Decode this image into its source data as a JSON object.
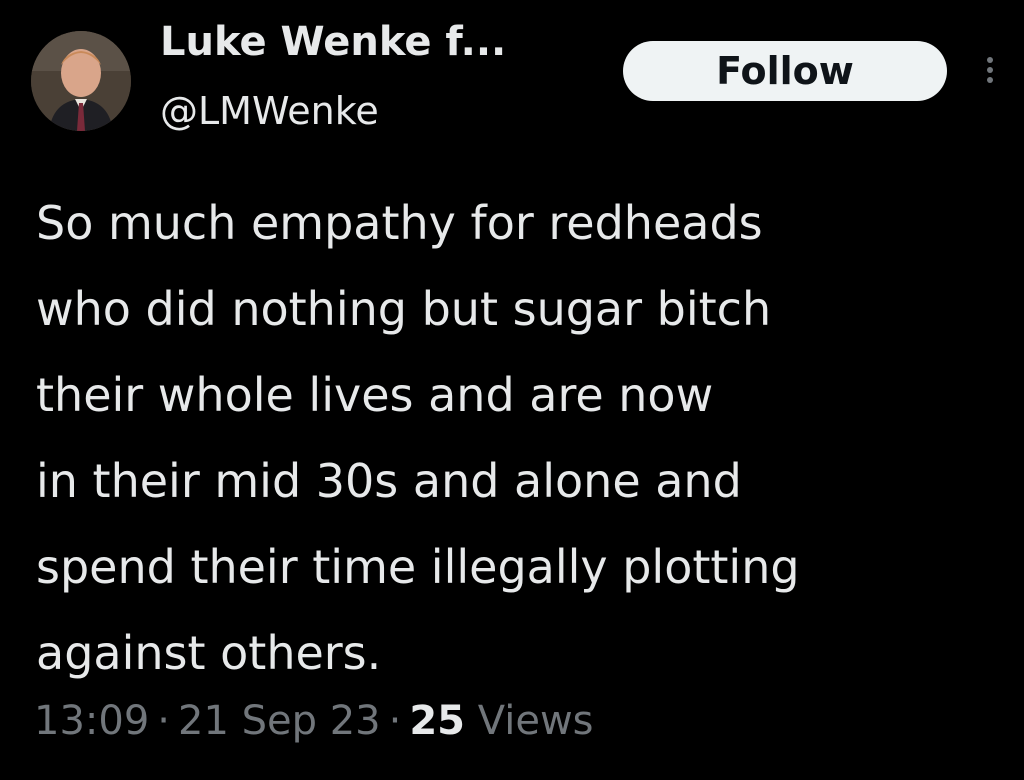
{
  "author": {
    "display_name": "Luke Wenke f...",
    "handle": "@LMWenke"
  },
  "actions": {
    "follow_label": "Follow",
    "more_icon": "more-vertical-icon"
  },
  "tweet": {
    "lines": [
      "So much empathy for redheads",
      "who did nothing but sugar bitch",
      "their whole lives and are now",
      "in their mid 30s and alone and",
      "spend their time illegally plotting",
      "against others."
    ],
    "time": "13:09",
    "date": "21 Sep 23",
    "separator": "·",
    "views_count": "25",
    "views_label": "Views"
  },
  "colors": {
    "background": "#000000",
    "primary_text": "#e7e9ea",
    "secondary_text": "#71767b",
    "follow_button_bg": "#eff3f4",
    "follow_button_text": "#0f1419"
  }
}
